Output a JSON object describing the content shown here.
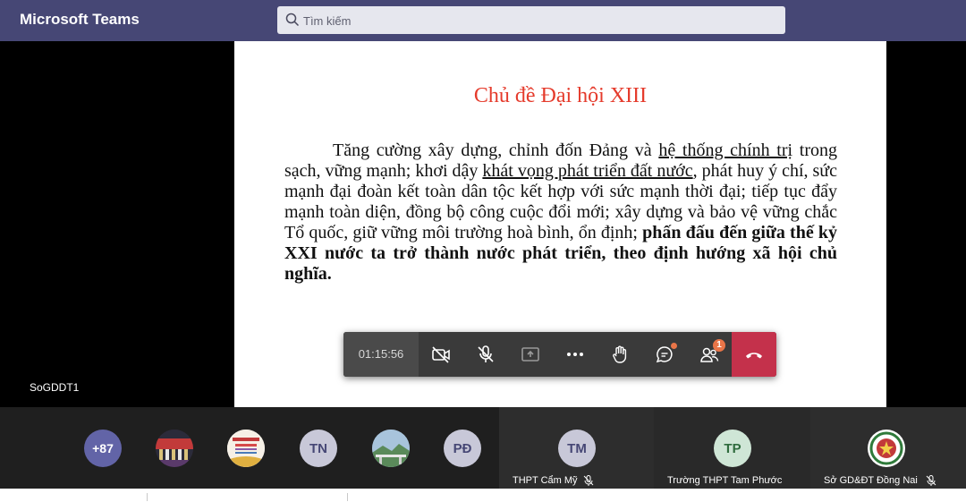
{
  "app": {
    "title": "Microsoft Teams"
  },
  "search": {
    "placeholder": "Tìm kiếm"
  },
  "presenter": {
    "name": "SoGDDT1"
  },
  "slide": {
    "title": "Chủ đề Đại hội XIII",
    "body": {
      "p1": "Tăng cường xây dựng, chỉnh đốn Đảng và ",
      "u1": "hệ thống chính trị",
      "p2": " trong sạch, vững mạnh; khơi dậy ",
      "u2": "khát vọng phát triển đất nước",
      "p3": ", phát huy ý chí, sức mạnh đại đoàn kết toàn dân tộc kết hợp với sức mạnh thời đại; tiếp tục đẩy mạnh toàn diện, đồng bộ công cuộc đổi mới; xây dựng và bảo vệ vững chắc Tổ quốc, giữ vững môi trường hoà bình, ổn định; ",
      "bold": "phấn đấu đến giữa thế kỷ XXI nước ta trở thành nước phát triển, theo định hướng xã hội chủ nghĩa."
    }
  },
  "controls": {
    "timer": "01:15:56",
    "participants_badge": "1",
    "icons": [
      "camera-off-icon",
      "mic-off-icon",
      "share-icon",
      "more-icon",
      "raise-hand-icon",
      "chat-icon",
      "participants-icon",
      "hang-up-icon"
    ]
  },
  "participants": {
    "overflow": "+87",
    "avatars": [
      {
        "initials": "TN"
      },
      {
        "initials": "PĐ"
      }
    ],
    "tiles": [
      {
        "initials": "TM",
        "name": "THPT Cẩm Mỹ"
      },
      {
        "initials": "TP",
        "name": "Trường THPT Tam Phước"
      },
      {
        "initials": "",
        "name": "Sở GD&ĐT Đồng Nai"
      }
    ]
  },
  "colors": {
    "titlebar": "#464775",
    "accent": "#6264a7",
    "hangup": "#c4314b",
    "slide_title": "#e53b2c",
    "badge": "#e97548"
  }
}
